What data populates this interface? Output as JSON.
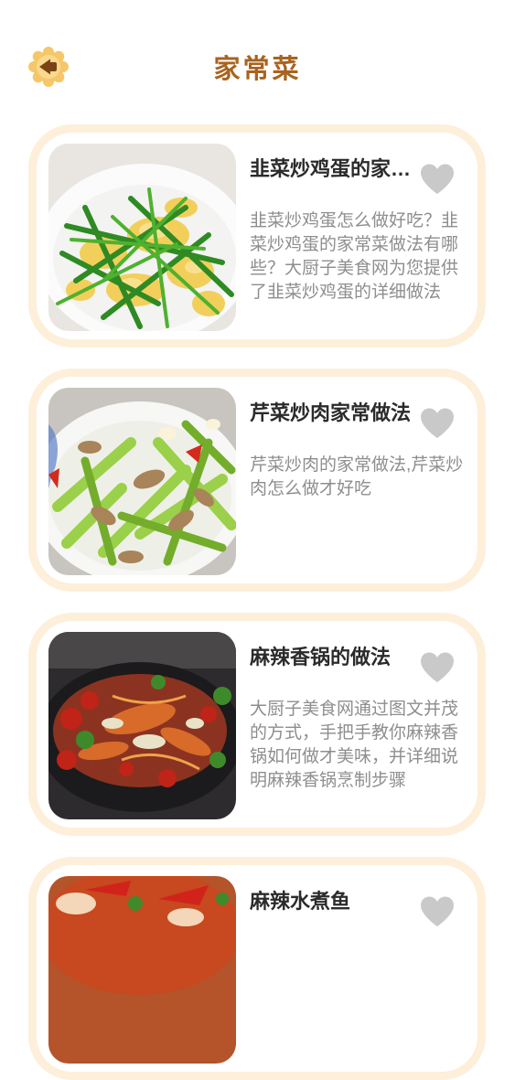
{
  "header": {
    "title": "家常菜",
    "back_icon": "back-arrow-icon"
  },
  "colors": {
    "title": "#a8631f",
    "card_border": "#fdefd9",
    "back_button": "#f6c768",
    "favorite_icon": "#c9c9c9",
    "description": "#8e8e8e"
  },
  "recipes": [
    {
      "title": "韭菜炒鸡蛋的家常做法",
      "description": "韭菜炒鸡蛋怎么做好吃？韭菜炒鸡蛋的家常菜做法有哪些？大厨子美食网为您提供了韭菜炒鸡蛋的详细做法",
      "favorite_icon": "heart-icon",
      "image": "chive-egg-dish"
    },
    {
      "title": "芹菜炒肉家常做法",
      "description": "芹菜炒肉的家常做法,芹菜炒肉怎么做才好吃",
      "favorite_icon": "heart-icon",
      "image": "celery-pork-dish"
    },
    {
      "title": "麻辣香锅的做法",
      "description": "大厨子美食网通过图文并茂的方式，手把手教你麻辣香锅如何做才美味，并详细说明麻辣香锅烹制步骤",
      "favorite_icon": "heart-icon",
      "image": "spicy-pot-dish"
    },
    {
      "title": "麻辣水煮鱼",
      "description": "",
      "favorite_icon": "heart-icon",
      "image": "boiled-fish-dish"
    }
  ]
}
